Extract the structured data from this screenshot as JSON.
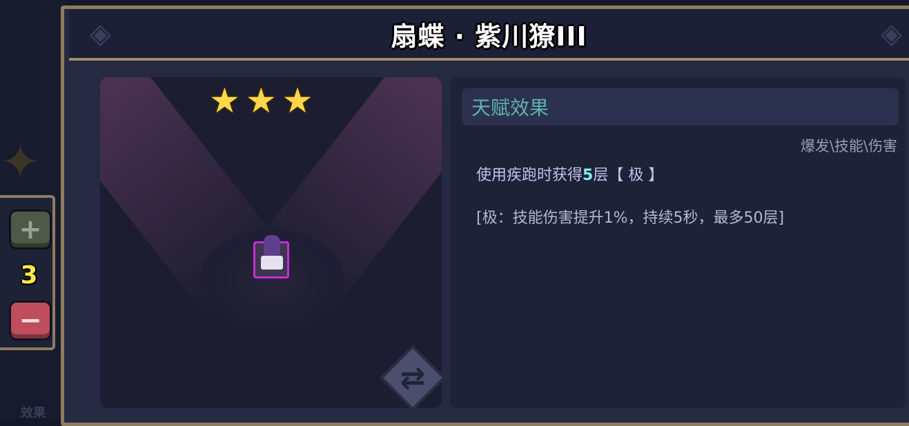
{
  "title": "扇蝶 · 紫川獠III",
  "stepper": {
    "plus_symbol": "+",
    "count": "3",
    "minus_symbol": "−"
  },
  "character": {
    "stars": [
      "★",
      "★",
      "★"
    ],
    "swap_icon": "swap-arrows-icon"
  },
  "talent": {
    "header": "天赋效果",
    "tags": "爆发\\技能\\伤害",
    "effect_prefix": "使用疾跑时获得",
    "effect_number": "5",
    "effect_suffix": "层【 极 】",
    "detail": "[极：技能伤害提升1%，持续5秒，最多50层]"
  },
  "background": {
    "ghost_label": "效果"
  },
  "colors": {
    "frame": "#8e7c5e",
    "panel": "#252a42",
    "talent_title": "#5fb3aa",
    "highlight_number": "#7ff3ee",
    "count": "#ffe94a",
    "character_border": "#c52fd8"
  }
}
